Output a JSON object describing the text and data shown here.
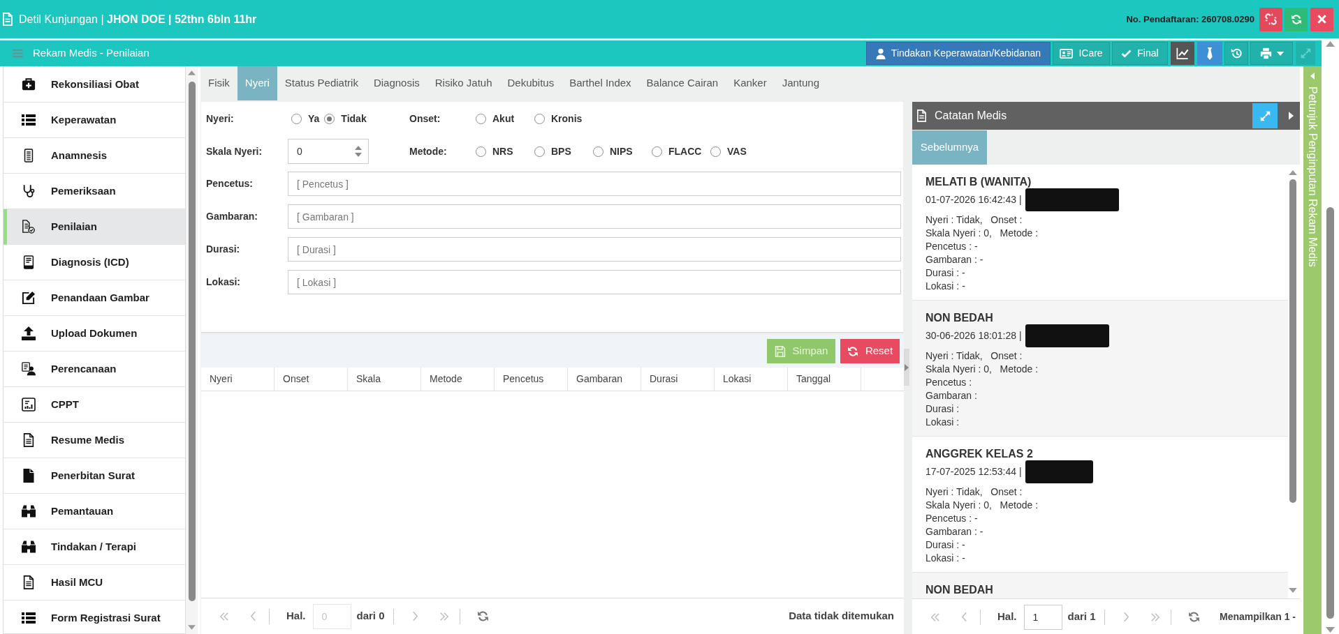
{
  "header": {
    "title": "Detil Kunjungan | **JHON DOE | 52thn 6bln 11hr**",
    "registration": "No. Pendaftaran: 260708.0290"
  },
  "toolbar": {
    "title": "Rekam Medis - Penilaian",
    "buttons": [
      {
        "label": "Tindakan Keperawatan/Kebidanan",
        "kind": "nursing"
      },
      {
        "label": "ICare",
        "kind": "icare"
      },
      {
        "label": "Final",
        "kind": "final"
      }
    ],
    "fullscreen_disabled": true
  },
  "sidebar": {
    "items": [
      {
        "label": "Rekonsiliasi Obat",
        "selected": false
      },
      {
        "label": "Keperawatan",
        "selected": false
      },
      {
        "label": "Anamnesis",
        "selected": false
      },
      {
        "label": "Pemeriksaan",
        "selected": false
      },
      {
        "label": "Penilaian",
        "selected": true
      },
      {
        "label": "Diagnosis (ICD)",
        "selected": false
      },
      {
        "label": "Penandaan Gambar",
        "selected": false
      },
      {
        "label": "Upload Dokumen",
        "selected": false
      },
      {
        "label": "Perencanaan",
        "selected": false
      },
      {
        "label": "CPPT",
        "selected": false
      },
      {
        "label": "Resume Medis",
        "selected": false
      },
      {
        "label": "Penerbitan Surat",
        "selected": false
      },
      {
        "label": "Pemantauan",
        "selected": false
      },
      {
        "label": "Tindakan / Terapi",
        "selected": false
      },
      {
        "label": "Hasil MCU",
        "selected": false
      },
      {
        "label": "Form Registrasi Surat",
        "selected": false
      }
    ]
  },
  "tabs": [
    {
      "label": "Fisik",
      "selected": false
    },
    {
      "label": "Nyeri",
      "selected": true
    },
    {
      "label": "Status Pediatrik",
      "selected": false
    },
    {
      "label": "Diagnosis",
      "selected": false
    },
    {
      "label": "Risiko Jatuh",
      "selected": false
    },
    {
      "label": "Dekubitus",
      "selected": false
    },
    {
      "label": "Barthel Index",
      "selected": false
    },
    {
      "label": "Balance Cairan",
      "selected": false
    },
    {
      "label": "Kanker",
      "selected": false
    },
    {
      "label": "Jantung",
      "selected": false
    }
  ],
  "form": {
    "nyeri": {
      "label": "Nyeri:",
      "options": [
        {
          "label": "Ya",
          "selected": false
        },
        {
          "label": "Tidak",
          "selected": true
        }
      ]
    },
    "onset": {
      "label": "Onset:",
      "options": [
        {
          "label": "Akut",
          "selected": false
        },
        {
          "label": "Kronis",
          "selected": false
        }
      ]
    },
    "skala": {
      "label": "Skala Nyeri:",
      "value": "0"
    },
    "metode": {
      "label": "Metode:",
      "options": [
        {
          "label": "NRS",
          "selected": false
        },
        {
          "label": "BPS",
          "selected": false
        },
        {
          "label": "NIPS",
          "selected": false
        },
        {
          "label": "FLACC",
          "selected": false
        },
        {
          "label": "VAS",
          "selected": false
        }
      ]
    },
    "fields": [
      {
        "label": "Pencetus:",
        "placeholder": "[ Pencetus ]"
      },
      {
        "label": "Gambaran:",
        "placeholder": "[ Gambaran ]"
      },
      {
        "label": "Durasi:",
        "placeholder": "[ Durasi ]"
      },
      {
        "label": "Lokasi:",
        "placeholder": "[ Lokasi ]"
      }
    ]
  },
  "actions": [
    {
      "label": "Simpan",
      "kind": "save",
      "disabled": true
    },
    {
      "label": "Reset",
      "kind": "reset",
      "disabled": false
    }
  ],
  "table": {
    "columns": [
      "Nyeri",
      "Onset",
      "Skala",
      "Metode",
      "Pencetus",
      "Gambaran",
      "Durasi",
      "Lokasi",
      "Tanggal"
    ]
  },
  "pager": {
    "page_label": "Hal.",
    "page": "0",
    "total": "dari 0",
    "info": "Data tidak ditemukan",
    "disabled": true
  },
  "records_panel": {
    "title": "Catatan Medis",
    "tabs": [
      {
        "label": "Sebelumnya",
        "selected": true
      }
    ],
    "records": [
      {
        "title": "MELATI B (WANITA)",
        "meta": "01-07-2026 16:42:43 |",
        "author_hidden": true,
        "lines": [
          "Nyeri : Tidak,   Onset :",
          "Skala Nyeri : 0,   Metode :",
          "Pencetus : -",
          "Gambaran : -",
          "Durasi : -",
          "Lokasi : -"
        ]
      },
      {
        "title": "NON BEDAH",
        "meta": "30-06-2026 18:01:28 |",
        "author_hidden": true,
        "lines": [
          "Nyeri : Tidak,   Onset :",
          "Skala Nyeri : 0,   Metode :",
          "Pencetus :",
          "Gambaran :",
          "Durasi :",
          "Lokasi :"
        ]
      },
      {
        "title": "ANGGREK KELAS 2",
        "meta": "17-07-2025 12:53:44 |",
        "author_hidden": true,
        "lines": [
          "Nyeri : Tidak,   Onset :",
          "Skala Nyeri : 0,   Metode :",
          "Pencetus : -",
          "Gambaran : -",
          "Durasi : -",
          "Lokasi : -"
        ]
      },
      {
        "title": "NON BEDAH"
      }
    ],
    "pager": {
      "page_label": "Hal.",
      "page": "1",
      "total": "dari 1",
      "info": "Menampilkan 1 -",
      "disabled": false
    }
  },
  "guide_panel": {
    "label": "Petunjuk Penginputan Rekam Medis"
  }
}
